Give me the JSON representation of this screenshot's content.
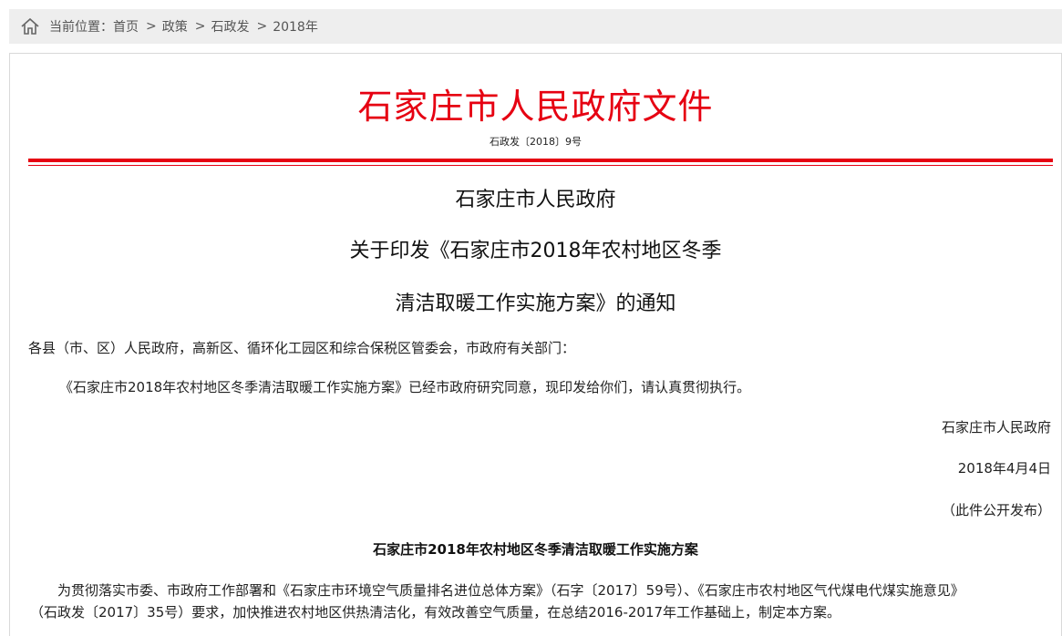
{
  "breadcrumb": {
    "prefix": "当前位置：",
    "items": [
      "首页",
      "政策",
      "石政发",
      "2018年"
    ],
    "separator": ">"
  },
  "doc": {
    "header": "石家庄市人民政府文件",
    "number": "石政发〔2018〕9号",
    "title_line1": "石家庄市人民政府",
    "title_line2": "关于印发《石家庄市2018年农村地区冬季",
    "title_line3": "清洁取暖工作实施方案》的通知",
    "greeting": "各县（市、区）人民政府，高新区、循环化工园区和综合保税区管委会，市政府有关部门：",
    "body1": "《石家庄市2018年农村地区冬季清洁取暖工作实施方案》已经市政府研究同意，现印发给你们，请认真贯彻执行。",
    "sign_org": "石家庄市人民政府",
    "sign_date": "2018年4月4日",
    "publish_note": "（此件公开发布）",
    "section_title": "石家庄市2018年农村地区冬季清洁取暖工作实施方案",
    "body2_line1": "为贯彻落实市委、市政府工作部署和《石家庄市环境空气质量排名进位总体方案》（石字〔2017〕59号）、《石家庄市农村地区气代煤电代煤实施意见》",
    "body2_line2": "（石政发〔2017〕35号）要求，加快推进农村地区供热清洁化，有效改善空气质量，在总结2016-2017年工作基础上，制定本方案。"
  },
  "colors": {
    "header_red": "#e60012",
    "breadcrumb_bg": "#eeeeee"
  },
  "icons": {
    "breadcrumb_home": "home-icon"
  }
}
